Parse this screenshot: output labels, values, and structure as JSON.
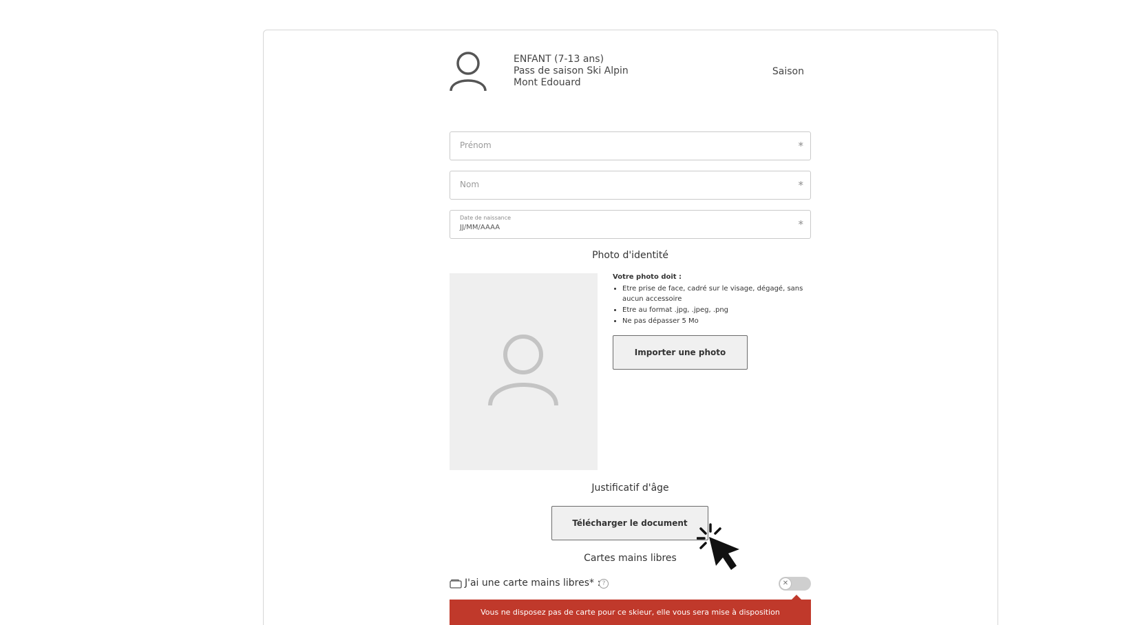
{
  "product": {
    "category": "ENFANT (7-13 ans)",
    "pass_name": "Pass de saison Ski Alpin",
    "resort": "Mont Edouard",
    "period": "Saison"
  },
  "form": {
    "first_name": {
      "placeholder": "Prénom",
      "required_mark": "*"
    },
    "last_name": {
      "placeholder": "Nom",
      "required_mark": "*"
    },
    "birth_date": {
      "label": "Date de naissance",
      "value": "JJ/MM/AAAA",
      "required_mark": "*"
    }
  },
  "photo": {
    "title": "Photo d'identité",
    "rules_heading": "Votre photo doit :",
    "rules": [
      "Etre prise de face, cadré sur le visage, dégagé, sans aucun accessoire",
      "Etre au format .jpg, .jpeg, .png",
      "Ne pas dépasser 5 Mo"
    ],
    "import_button": "Importer une photo"
  },
  "age_proof": {
    "title": "Justificatif d'âge",
    "upload_button": "Télécharger le document"
  },
  "hands_free": {
    "title": "Cartes mains libres",
    "question": "J'ai une carte mains libres* :",
    "help": "?",
    "toggle_off_symbol": "✕",
    "alert": "Vous ne disposez pas de carte pour ce skieur, elle vous sera mise à disposition"
  },
  "colors": {
    "alert": "#c0392b",
    "placeholder_box": "#efefef",
    "button_bg": "#f0f0f0"
  }
}
